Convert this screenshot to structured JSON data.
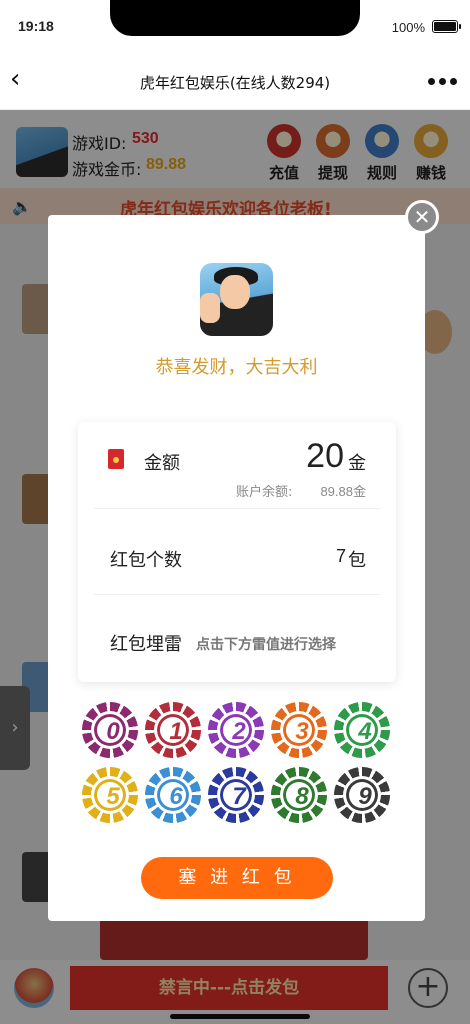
{
  "status_bar": {
    "time": "19:18",
    "battery": "100%"
  },
  "nav": {
    "title": "虎年红包娱乐(在线人数294)"
  },
  "user": {
    "id_label": "游戏ID:",
    "id_value": "530",
    "coin_label": "游戏金币:",
    "coin_value": "89.88"
  },
  "actions": [
    {
      "label": "充值",
      "color": "#c8322b"
    },
    {
      "label": "提现",
      "color": "#d46a2e"
    },
    {
      "label": "规则",
      "color": "#3f7ac7"
    },
    {
      "label": "赚钱",
      "color": "#e4a838"
    }
  ],
  "marquee": {
    "text": "虎年红包娱乐欢迎各位老板!"
  },
  "modal": {
    "greeting": "恭喜发财，大吉大利",
    "amount_label": "金额",
    "amount_value": "20",
    "amount_unit": "金",
    "balance_label": "账户余额:",
    "balance_value": "89.88金",
    "count_label": "红包个数",
    "count_value": "7",
    "count_unit": "包",
    "mine_label": "红包埋雷",
    "mine_hint": "点击下方雷值进行选择",
    "submit_label": "塞 进 红 包",
    "chips": [
      {
        "num": "0",
        "color": "#8b2a6e"
      },
      {
        "num": "1",
        "color": "#b22e3a"
      },
      {
        "num": "2",
        "color": "#8a3ab4"
      },
      {
        "num": "3",
        "color": "#e26a1e"
      },
      {
        "num": "4",
        "color": "#2e9a4a"
      },
      {
        "num": "5",
        "color": "#e0b01a"
      },
      {
        "num": "6",
        "color": "#3b8fd2"
      },
      {
        "num": "7",
        "color": "#2a3a9e"
      },
      {
        "num": "8",
        "color": "#2f7a2e"
      },
      {
        "num": "9",
        "color": "#3a3a3a"
      }
    ]
  },
  "bottom": {
    "mute_label": "禁言中---点击发包"
  },
  "colors": {
    "accent": "#ff6a0e",
    "greeting": "#d49b2c",
    "danger": "#e0312a"
  }
}
